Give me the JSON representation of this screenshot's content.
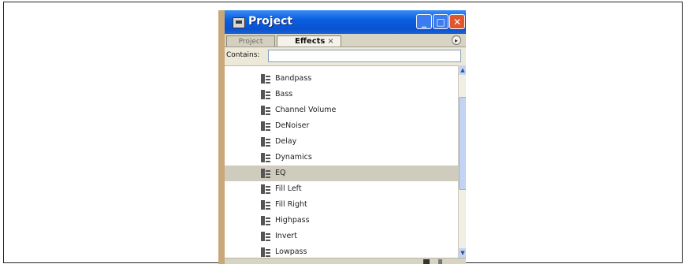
{
  "window": {
    "title": "Project"
  },
  "titlebar_buttons": {
    "minimize": "_",
    "maximize": "□",
    "close": "✕"
  },
  "tabs": [
    {
      "label": "Project"
    },
    {
      "label": "Effects",
      "close": "×"
    }
  ],
  "panel_menu_glyph": "▸",
  "search": {
    "label": "Contains:",
    "value": ""
  },
  "scrollbar": {
    "up": "▲",
    "down": "▼"
  },
  "effects": [
    {
      "label": "Bandpass",
      "selected": false
    },
    {
      "label": "Bass",
      "selected": false
    },
    {
      "label": "Channel Volume",
      "selected": false
    },
    {
      "label": "DeNoiser",
      "selected": false
    },
    {
      "label": "Delay",
      "selected": false
    },
    {
      "label": "Dynamics",
      "selected": false
    },
    {
      "label": "EQ",
      "selected": true
    },
    {
      "label": "Fill Left",
      "selected": false
    },
    {
      "label": "Fill Right",
      "selected": false
    },
    {
      "label": "Highpass",
      "selected": false
    },
    {
      "label": "Invert",
      "selected": false
    },
    {
      "label": "Lowpass",
      "selected": false
    }
  ]
}
